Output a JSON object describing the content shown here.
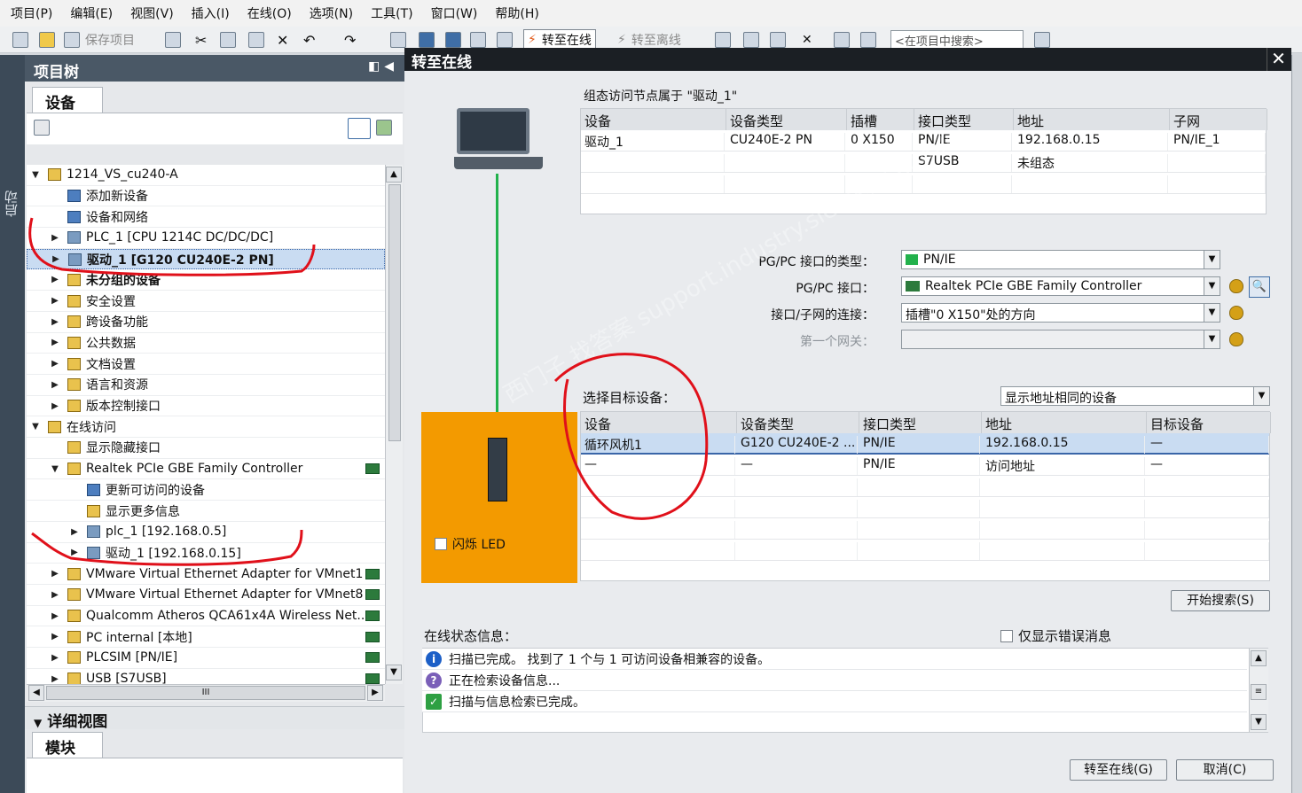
{
  "menu": [
    "项目(P)",
    "编辑(E)",
    "视图(V)",
    "插入(I)",
    "在线(O)",
    "选项(N)",
    "工具(T)",
    "窗口(W)",
    "帮助(H)"
  ],
  "toolbar": {
    "save_project": "保存项目",
    "go_online": "转至在线",
    "go_offline": "转至离线",
    "search_placeholder": "<在项目中搜索>"
  },
  "sidebar_tab": "启动",
  "project_tree": {
    "title": "项目树",
    "devices_tab": "设备",
    "items": [
      {
        "label": "1214_VS_cu240-A",
        "arrow": "▼",
        "indent": 0,
        "icon": "project-icon"
      },
      {
        "label": "添加新设备",
        "arrow": "",
        "indent": 1,
        "icon": "add-device-icon"
      },
      {
        "label": "设备和网络",
        "arrow": "",
        "indent": 1,
        "icon": "network-icon"
      },
      {
        "label": "PLC_1 [CPU 1214C DC/DC/DC]",
        "arrow": "▶",
        "indent": 1,
        "icon": "plc-icon"
      },
      {
        "label": "驱动_1 [G120 CU240E-2 PN]",
        "arrow": "▶",
        "indent": 1,
        "icon": "drive-icon",
        "selected": true
      },
      {
        "label": "未分组的设备",
        "arrow": "▶",
        "indent": 1,
        "icon": "folder-icon"
      },
      {
        "label": "安全设置",
        "arrow": "▶",
        "indent": 1,
        "icon": "security-icon"
      },
      {
        "label": "跨设备功能",
        "arrow": "▶",
        "indent": 1,
        "icon": "cross-device-icon"
      },
      {
        "label": "公共数据",
        "arrow": "▶",
        "indent": 1,
        "icon": "common-data-icon"
      },
      {
        "label": "文档设置",
        "arrow": "▶",
        "indent": 1,
        "icon": "doc-settings-icon"
      },
      {
        "label": "语言和资源",
        "arrow": "▶",
        "indent": 1,
        "icon": "language-icon"
      },
      {
        "label": "版本控制接口",
        "arrow": "▶",
        "indent": 1,
        "icon": "version-control-icon"
      },
      {
        "label": "在线访问",
        "arrow": "▼",
        "indent": 0,
        "icon": "online-access-icon"
      },
      {
        "label": "显示隐藏接口",
        "arrow": "",
        "indent": 1,
        "icon": "show-hidden-icon"
      },
      {
        "label": "Realtek PCIe GBE Family Controller",
        "arrow": "▼",
        "indent": 1,
        "icon": "nic-icon",
        "status": true
      },
      {
        "label": "更新可访问的设备",
        "arrow": "",
        "indent": 2,
        "icon": "update-accessible-icon"
      },
      {
        "label": "显示更多信息",
        "arrow": "",
        "indent": 2,
        "icon": "more-info-icon"
      },
      {
        "label": "plc_1 [192.168.0.5]",
        "arrow": "▶",
        "indent": 2,
        "icon": "plc-icon"
      },
      {
        "label": "驱动_1 [192.168.0.15]",
        "arrow": "▶",
        "indent": 2,
        "icon": "drive-icon"
      },
      {
        "label": "VMware Virtual Ethernet Adapter for VMnet1",
        "arrow": "▶",
        "indent": 1,
        "icon": "nic-icon",
        "status": true
      },
      {
        "label": "VMware Virtual Ethernet Adapter for VMnet8",
        "arrow": "▶",
        "indent": 1,
        "icon": "nic-icon",
        "status": true
      },
      {
        "label": "Qualcomm Atheros QCA61x4A Wireless Net...",
        "arrow": "▶",
        "indent": 1,
        "icon": "nic-icon",
        "status": true
      },
      {
        "label": "PC internal [本地]",
        "arrow": "▶",
        "indent": 1,
        "icon": "nic-icon",
        "status": true
      },
      {
        "label": "PLCSIM [PN/IE]",
        "arrow": "▶",
        "indent": 1,
        "icon": "nic-icon",
        "status": true
      },
      {
        "label": "USB [S7USB]",
        "arrow": "▶",
        "indent": 1,
        "icon": "nic-icon",
        "status": true
      }
    ],
    "hscroll_thumb": "III"
  },
  "detail_view": {
    "title": "详细视图",
    "module_tab": "模块"
  },
  "dialog": {
    "title": "转至在线",
    "config_caption": "组态访问节点属于 \"驱动_1\"",
    "config_table": {
      "headers": [
        "设备",
        "设备类型",
        "插槽",
        "接口类型",
        "地址",
        "子网"
      ],
      "rows": [
        [
          "驱动_1",
          "CU240E-2 PN",
          "0 X150",
          "PN/IE",
          "192.168.0.15",
          "PN/IE_1"
        ],
        [
          "",
          "",
          "",
          "S7USB",
          "未组态",
          ""
        ],
        [
          "",
          "",
          "",
          "",
          "",
          ""
        ]
      ]
    },
    "pgpc_type_label": "PG/PC 接口的类型：",
    "pgpc_type_value": "PN/IE",
    "pgpc_iface_label": "PG/PC 接口：",
    "pgpc_iface_value": "Realtek PCIe GBE Family Controller",
    "subnet_conn_label": "接口/子网的连接：",
    "subnet_conn_value": "插槽\"0 X150\"处的方向",
    "gateway_label": "第一个网关：",
    "gateway_value": "",
    "target_caption": "选择目标设备：",
    "target_filter": "显示地址相同的设备",
    "target_table": {
      "headers": [
        "设备",
        "设备类型",
        "接口类型",
        "地址",
        "目标设备"
      ],
      "rows": [
        [
          "循环风机1",
          "G120 CU240E-2 ...",
          "PN/IE",
          "192.168.0.15",
          "—"
        ],
        [
          "—",
          "—",
          "PN/IE",
          "访问地址",
          "—"
        ]
      ]
    },
    "flash_led": "闪烁 LED",
    "start_search": "开始搜索(S)",
    "status_caption": "在线状态信息：",
    "only_errors": "仅显示错误消息",
    "status_messages": [
      {
        "icon": "info-icon",
        "text": "扫描已完成。 找到了 1 个与 1 可访问设备相兼容的设备。"
      },
      {
        "icon": "searching-icon",
        "text": "正在检索设备信息..."
      },
      {
        "icon": "check-icon",
        "text": "扫描与信息检索已完成。"
      }
    ],
    "btn_go_online": "转至在线(G)",
    "btn_cancel": "取消(C)"
  },
  "watermark": "西门子 找答案 support.industry.siemens.com/cs",
  "colors": {
    "accent": "#f39a00",
    "link_line": "#22b14c",
    "annotation": "#e0101a",
    "header_dark": "#1b1f24"
  }
}
